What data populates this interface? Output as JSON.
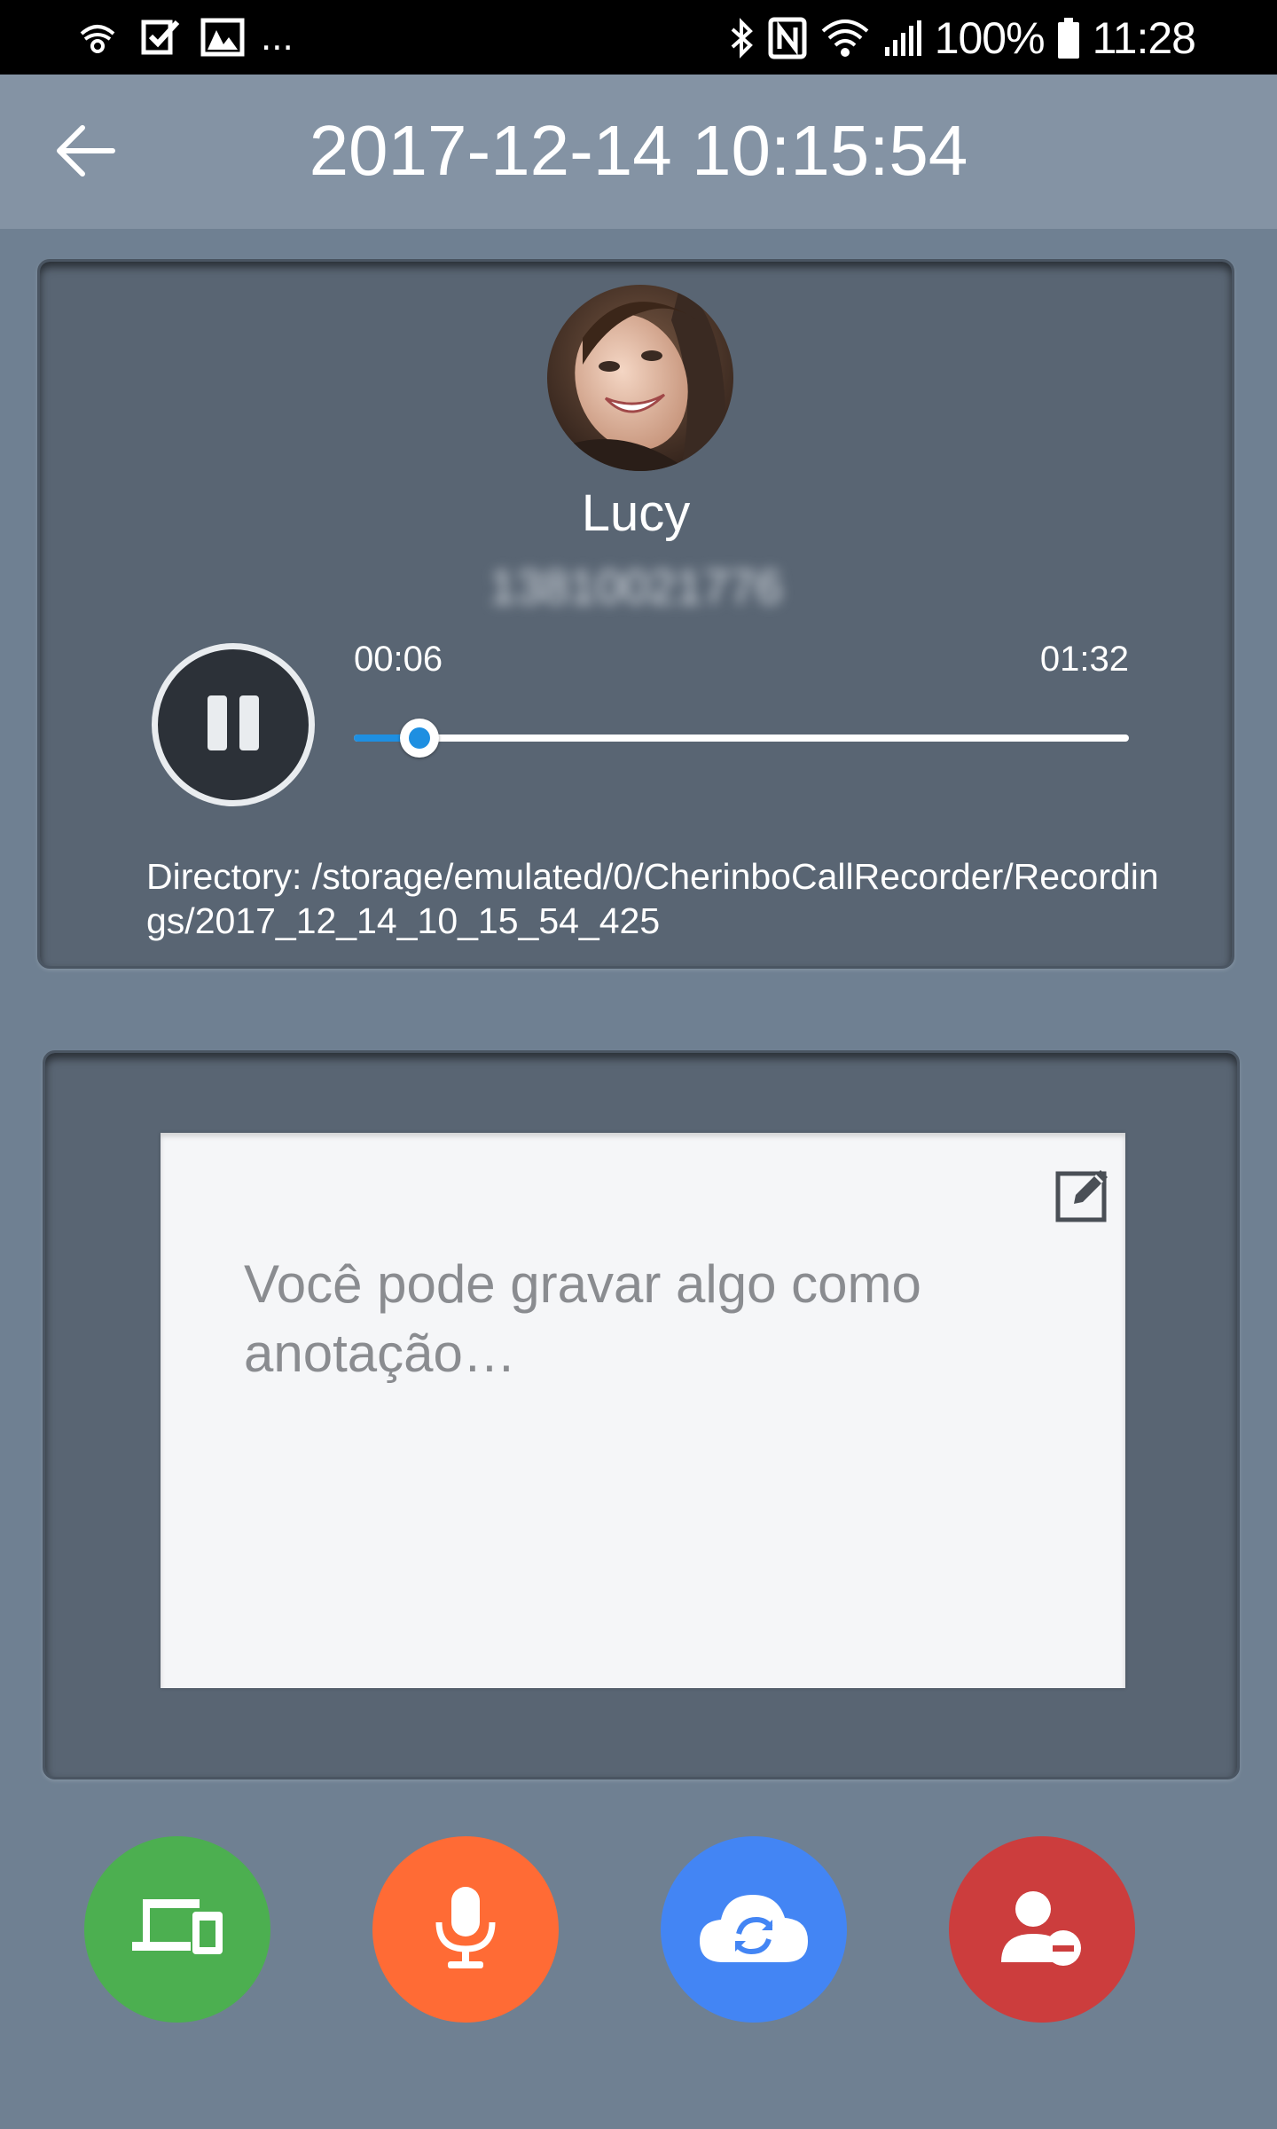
{
  "status_bar": {
    "battery_text": "100%",
    "time": "11:28",
    "overflow_text": "...",
    "left_icons": [
      "missed-call-icon",
      "task-check-icon",
      "gallery-icon"
    ],
    "right_icons": [
      "bluetooth-icon",
      "nfc-icon",
      "wifi-icon",
      "signal-icon",
      "battery-icon"
    ]
  },
  "app_bar": {
    "back_icon": "arrow-left-icon",
    "title": "2017-12-14 10:15:54"
  },
  "player": {
    "contact_name": "Lucy",
    "contact_number": "13810021776",
    "current_time": "00:06",
    "total_time": "01:32",
    "progress_fraction": 0.085,
    "play_state": "playing",
    "directory_text": "Directory: /storage/emulated/0/CherinboCallRecorder/Recordings/2017_12_14_10_15_54_425"
  },
  "note": {
    "placeholder": "Você pode gravar algo como anotação…",
    "edit_icon": "edit-icon"
  },
  "actions": [
    {
      "name": "devices-button",
      "icon": "devices-icon",
      "color": "#4caf50"
    },
    {
      "name": "record-button",
      "icon": "microphone-icon",
      "color": "#ff6b35"
    },
    {
      "name": "cloud-sync-button",
      "icon": "cloud-sync-icon",
      "color": "#4385f4"
    },
    {
      "name": "remove-contact-button",
      "icon": "remove-user-icon",
      "color": "#cc3d3d"
    }
  ],
  "colors": {
    "background": "#6f8092",
    "app_bar": "#8493a4",
    "card": "#596573",
    "accent": "#1e8fe1"
  }
}
